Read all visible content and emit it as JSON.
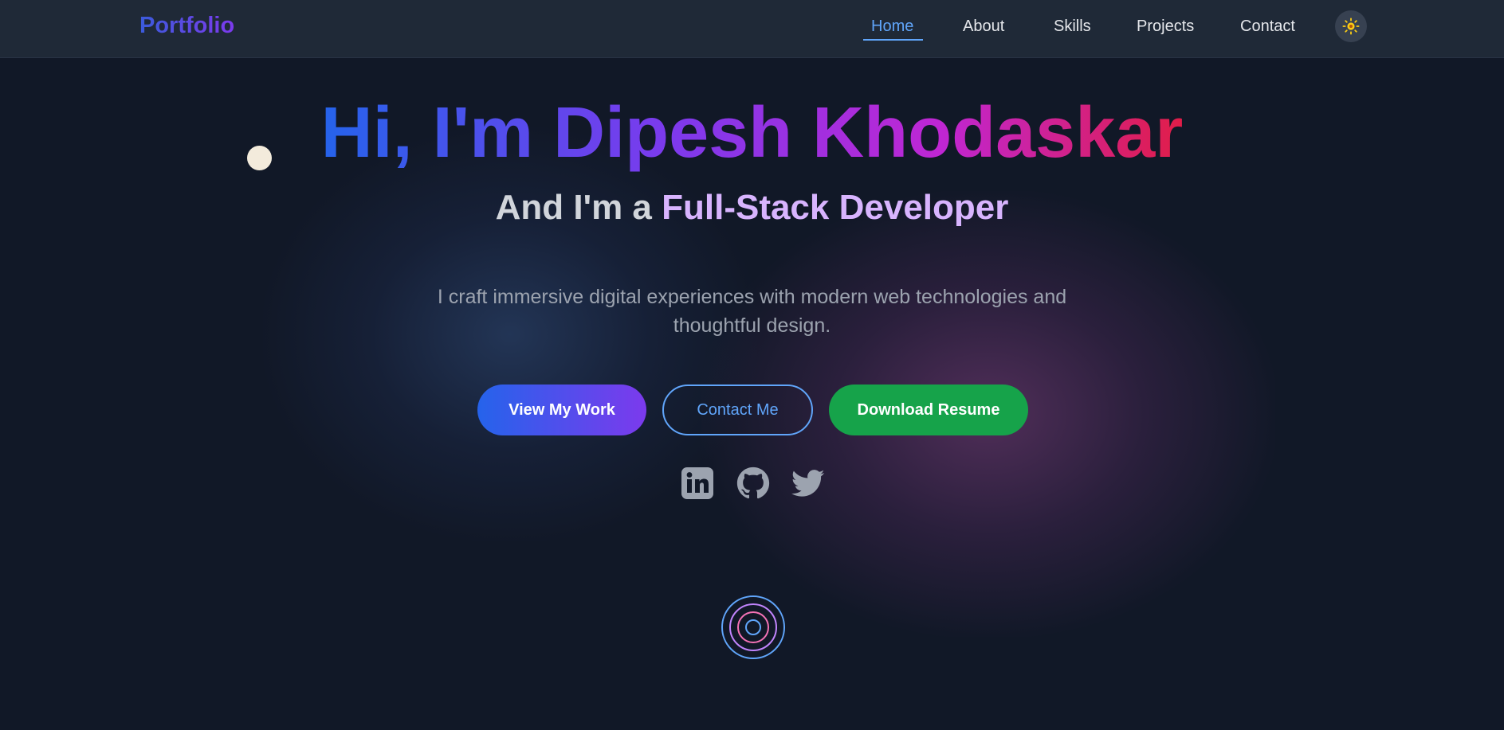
{
  "nav": {
    "logo": "Portfolio",
    "items": [
      {
        "label": "Home",
        "active": true
      },
      {
        "label": "About",
        "active": false
      },
      {
        "label": "Skills",
        "active": false
      },
      {
        "label": "Projects",
        "active": false
      },
      {
        "label": "Contact",
        "active": false
      }
    ],
    "theme_toggle_icon": "sun-icon"
  },
  "hero": {
    "title": "Hi, I'm Dipesh Khodaskar",
    "subtitle_prefix": "And I'm a ",
    "subtitle_role": "Full-Stack Developer",
    "description_line1": "I craft immersive digital experiences with modern web technologies and",
    "description_line2": "thoughtful design."
  },
  "buttons": {
    "view_work": "View My Work",
    "contact": "Contact Me",
    "resume": "Download Resume"
  },
  "socials": [
    {
      "icon": "linkedin-icon"
    },
    {
      "icon": "github-icon"
    },
    {
      "icon": "twitter-icon"
    }
  ],
  "colors": {
    "background": "#111827",
    "navbar": "#1f2937",
    "accent_blue": "#60a5fa",
    "accent_purple": "#7c3aed",
    "accent_pink": "#e11d48",
    "resume_green": "#16a34a",
    "sun_yellow": "#facc15"
  }
}
